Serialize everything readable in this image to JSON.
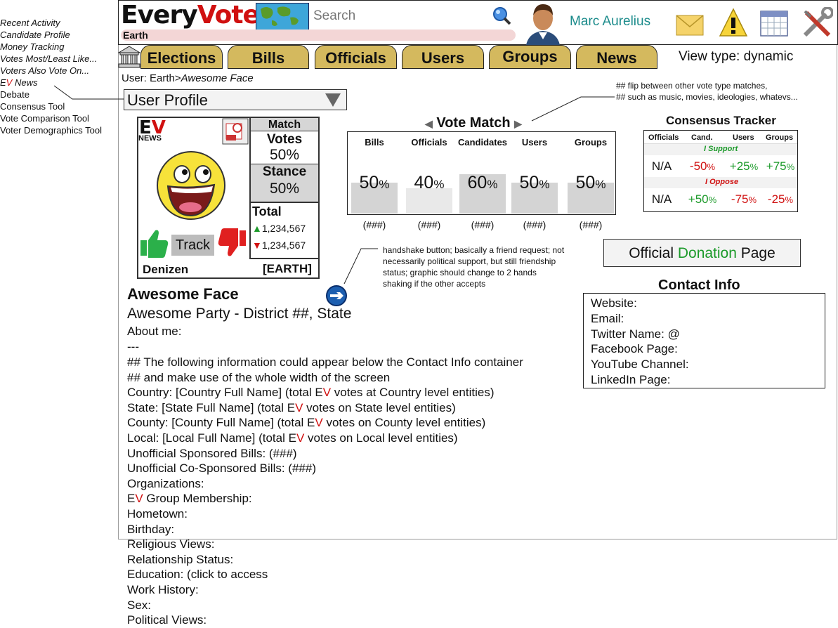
{
  "sidebar": {
    "items": [
      {
        "label": "Recent Activity"
      },
      {
        "label": "Candidate Profile"
      },
      {
        "label": "Money Tracking"
      },
      {
        "label": "Votes Most/Least Like..."
      },
      {
        "label": "Voters Also Vote On..."
      },
      {
        "label_prefix_e": "E",
        "label_prefix_v": "V",
        "label": " News"
      },
      {
        "label": "Debate"
      },
      {
        "label": "Consensus Tool"
      },
      {
        "label": "Vote Comparison Tool"
      },
      {
        "label": "Voter Demographics Tool"
      }
    ]
  },
  "header": {
    "logo_every": "Every",
    "logo_vote": "Vote",
    "scope": "Earth",
    "search_placeholder": "Search",
    "user_name": "Marc Aurelius",
    "icons": [
      "map-icon",
      "search-icon",
      "avatar",
      "mail-icon",
      "warning-icon",
      "calendar-icon",
      "tools-icon"
    ]
  },
  "tabs": [
    "Elections",
    "Bills",
    "Officials",
    "Users",
    "Groups",
    "News"
  ],
  "view_type": "View type: dynamic",
  "breadcrumb": {
    "prefix": "User: Earth>",
    "current": "Awesome Face"
  },
  "profile_select": "User Profile",
  "card": {
    "ev_e": "E",
    "ev_v": "V",
    "news": "NEWS",
    "match_label": "Match",
    "votes_label": "Votes",
    "votes_value": "50%",
    "stance_label": "Stance",
    "stance_value": "50%",
    "total_label": "Total",
    "total_up": "1,234,567",
    "total_down": "1,234,567",
    "track_label": "Track",
    "role": "Denizen",
    "region": "[EARTH]"
  },
  "vote_match": {
    "title": "Vote Match",
    "note_line1": "## flip between other vote type matches,",
    "note_line2": "## such as music, movies, ideologies, whatevs...",
    "columns": [
      {
        "label": "Bills",
        "value": "50",
        "unit": "%",
        "count": "(###)",
        "level": 0.5
      },
      {
        "label": "Officials",
        "value": "40",
        "unit": "%",
        "count": "(###)",
        "level": 0.4
      },
      {
        "label": "Candidates",
        "value": "60",
        "unit": "%",
        "count": "(###)",
        "level": 0.6
      },
      {
        "label": "Users",
        "value": "50",
        "unit": "%",
        "count": "(###)",
        "level": 0.5
      },
      {
        "label": "Groups",
        "value": "50",
        "unit": "%",
        "count": "(###)",
        "level": 0.5
      }
    ]
  },
  "consensus": {
    "title": "Consensus Tracker",
    "headers": [
      "Officials",
      "Cand.",
      "Users",
      "Groups"
    ],
    "support_label": "I Support",
    "oppose_label": "I Oppose",
    "support_row": [
      {
        "v": "N/A",
        "u": ""
      },
      {
        "v": "-50",
        "u": "%"
      },
      {
        "v": "+25",
        "u": "%"
      },
      {
        "v": "+75",
        "u": "%"
      }
    ],
    "oppose_row": [
      {
        "v": "N/A",
        "u": ""
      },
      {
        "v": "+50",
        "u": "%"
      },
      {
        "v": "-75",
        "u": "%"
      },
      {
        "v": "-25",
        "u": "%"
      }
    ]
  },
  "handshake_note": {
    "l1": "handshake button; basically a friend request; not",
    "l2": "necessarily political support, but still friendship",
    "l3": "status; graphic should change to 2 hands",
    "l4": "shaking if the other accepts"
  },
  "donation": {
    "pre": "Official ",
    "mid": "Donation",
    "post": " Page"
  },
  "contact": {
    "title": "Contact Info",
    "fields": [
      "Website:",
      "Email:",
      "Twitter Name: @",
      "Facebook Page:",
      "YouTube Channel:",
      "LinkedIn Page:"
    ]
  },
  "profile": {
    "name": "Awesome Face",
    "party": "Awesome Party - District ##, State",
    "about": "About me:",
    "sep": "---",
    "note1": "## The following information could appear below the Contact Info container",
    "note2": "## and make use of the whole width of the screen",
    "country": {
      "a": "Country: [Country Full Name] (total ",
      "b": " votes at Country level entities)"
    },
    "state": {
      "a": "State: [State Full Name] (total ",
      "b": " votes on State level entities)"
    },
    "county": {
      "a": "County: [County Full Name] (total ",
      "b": " votes on County level entities)"
    },
    "local": {
      "a": "Local: [Local Full Name] (total ",
      "b": " votes on Local level entities)"
    },
    "unofficial_sponsored": "Unofficial Sponsored Bills: (###)",
    "unofficial_cosponsored": "Unofficial Co-Sponsored Bills: (###)",
    "organizations": "Organizations:",
    "group_membership": " Group Membership:",
    "rest": [
      "Hometown:",
      "Birthday:",
      "Religious Views:",
      "Relationship Status:",
      "Education: (click to access",
      "Work History:",
      "Sex:",
      "Political Views:"
    ]
  }
}
